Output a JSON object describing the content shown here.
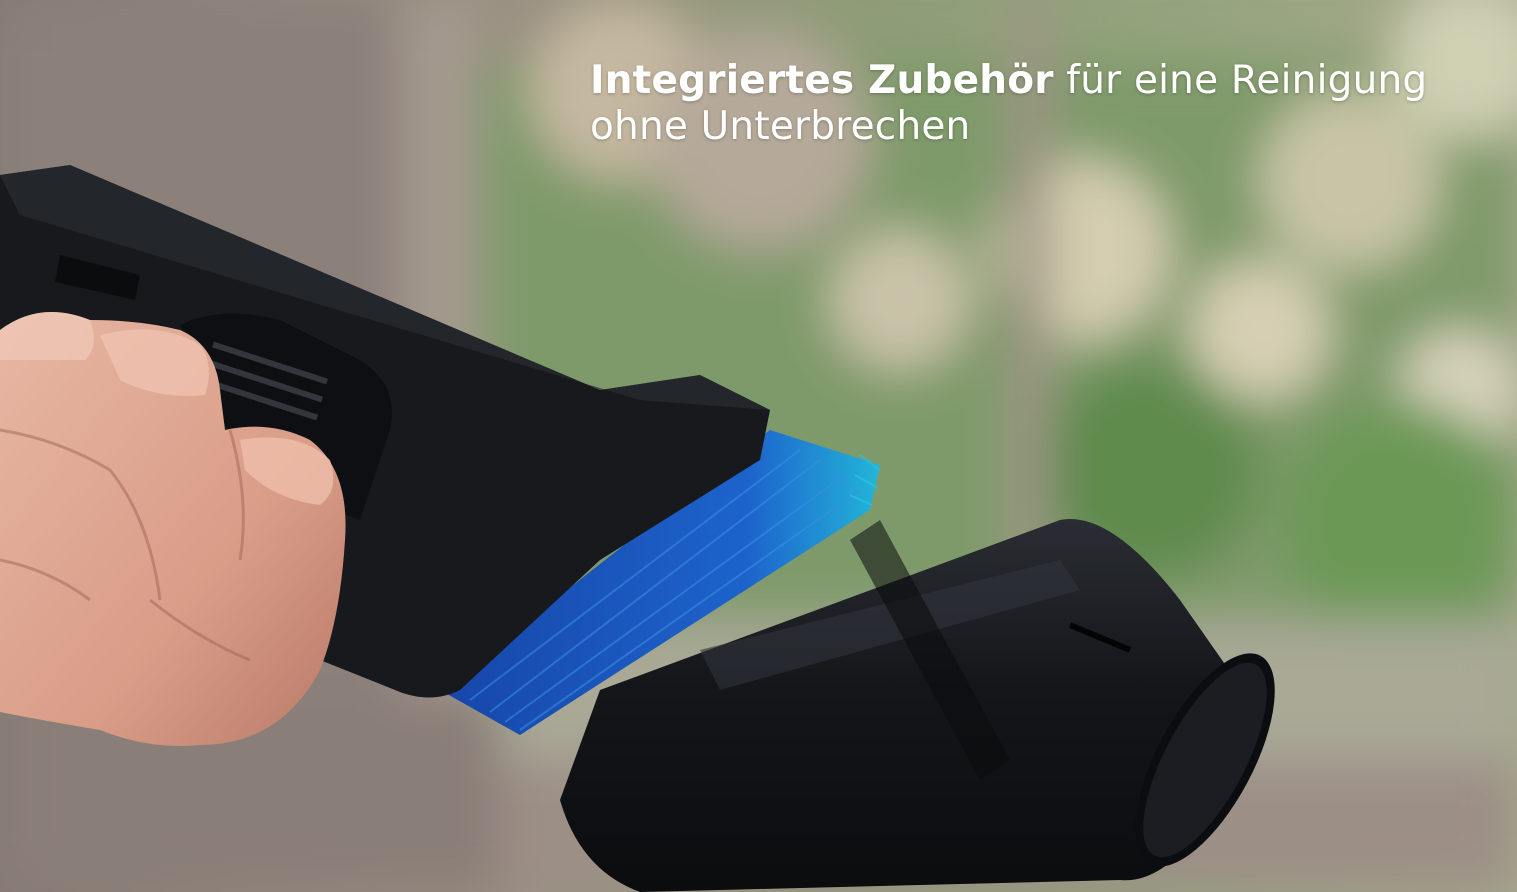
{
  "headline": {
    "bold": "Integriertes Zubehör",
    "rest": " für eine Reinigung",
    "line2": "ohne Unterbrechen"
  },
  "colors": {
    "text": "#ffffff",
    "brush": "#1b63c8",
    "brush_tip": "#22b7d6",
    "tool": "#16181c"
  }
}
